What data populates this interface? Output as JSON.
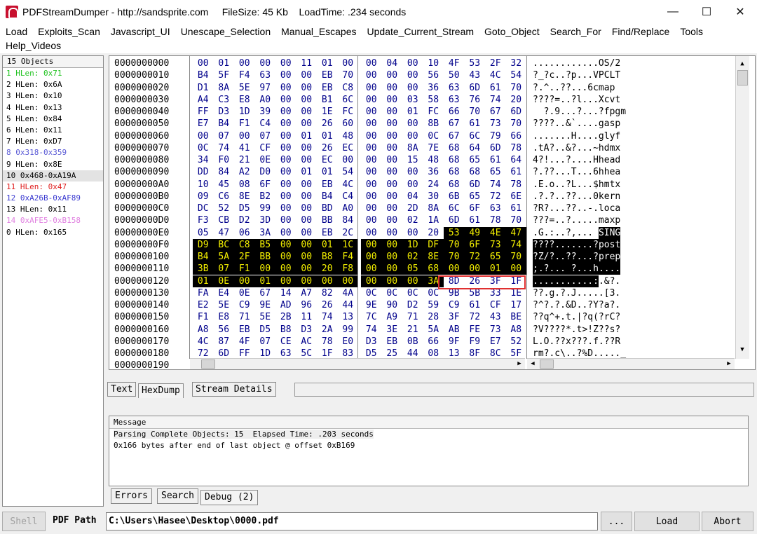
{
  "window": {
    "title": "PDFStreamDumper - http://sandsprite.com     FileSize: 45 Kb    LoadTime: .234 seconds",
    "minimize": "—",
    "maximize": "☐",
    "close": "✕",
    "accent": "#c8102e"
  },
  "menu": {
    "row1": [
      "Load",
      "Exploits_Scan",
      "Javascript_UI",
      "Unescape_Selection",
      "Manual_Escapes",
      "Update_Current_Stream",
      "Goto_Object",
      "Search_For",
      "Find/Replace",
      "Tools"
    ],
    "row2": [
      "Help_Videos"
    ]
  },
  "objects": {
    "header": "15 Objects",
    "items": [
      {
        "label": "1 HLen: 0x71",
        "color": "#22c322"
      },
      {
        "label": "2 HLen: 0x6A",
        "color": "#000000"
      },
      {
        "label": "3 HLen: 0x10",
        "color": "#000000"
      },
      {
        "label": "4 HLen: 0x13",
        "color": "#000000"
      },
      {
        "label": "5 HLen: 0x84",
        "color": "#000000"
      },
      {
        "label": "6 HLen: 0x11",
        "color": "#000000"
      },
      {
        "label": "7 HLen: 0xD7",
        "color": "#000000"
      },
      {
        "label": "8 0x318-0x359",
        "color": "#5b5bd6"
      },
      {
        "label": "9 HLen: 0x8E",
        "color": "#000000"
      },
      {
        "label": "10 0x468-0xA19A",
        "color": "#000000",
        "selected": true
      },
      {
        "label": "11 HLen: 0x47",
        "color": "#e02020"
      },
      {
        "label": "12 0xA26B-0xAF89",
        "color": "#3a3ad0"
      },
      {
        "label": "13 HLen: 0x11",
        "color": "#000000"
      },
      {
        "label": "14 0xAFE5-0xB158",
        "color": "#e080e0"
      },
      {
        "label": "0 HLen: 0x165",
        "color": "#000000"
      }
    ]
  },
  "hexdump": {
    "rows": [
      {
        "offset": "0000000000",
        "bytes": [
          "00",
          "01",
          "00",
          "00",
          "00",
          "11",
          "01",
          "00",
          "00",
          "04",
          "00",
          "10",
          "4F",
          "53",
          "2F",
          "32"
        ],
        "ascii": "............OS/2"
      },
      {
        "offset": "0000000010",
        "bytes": [
          "B4",
          "5F",
          "F4",
          "63",
          "00",
          "00",
          "EB",
          "70",
          "00",
          "00",
          "00",
          "56",
          "50",
          "43",
          "4C",
          "54"
        ],
        "ascii": "?_?c..?p...VPCLT"
      },
      {
        "offset": "0000000020",
        "bytes": [
          "D1",
          "8A",
          "5E",
          "97",
          "00",
          "00",
          "EB",
          "C8",
          "00",
          "00",
          "00",
          "36",
          "63",
          "6D",
          "61",
          "70"
        ],
        "ascii": "?.^..??...6cmap"
      },
      {
        "offset": "0000000030",
        "bytes": [
          "A4",
          "C3",
          "E8",
          "A0",
          "00",
          "00",
          "B1",
          "6C",
          "00",
          "00",
          "03",
          "58",
          "63",
          "76",
          "74",
          "20"
        ],
        "ascii": "????=..?l...Xcvt"
      },
      {
        "offset": "0000000040",
        "bytes": [
          "FF",
          "D3",
          "1D",
          "39",
          "00",
          "00",
          "1E",
          "FC",
          "00",
          "00",
          "01",
          "FC",
          "66",
          "70",
          "67",
          "6D"
        ],
        "ascii": "  ?.9...?...?fpgm"
      },
      {
        "offset": "0000000050",
        "bytes": [
          "E7",
          "B4",
          "F1",
          "C4",
          "00",
          "00",
          "26",
          "60",
          "00",
          "00",
          "00",
          "8B",
          "67",
          "61",
          "73",
          "70"
        ],
        "ascii": "????..&`....gasp"
      },
      {
        "offset": "0000000060",
        "bytes": [
          "00",
          "07",
          "00",
          "07",
          "00",
          "01",
          "01",
          "48",
          "00",
          "00",
          "00",
          "0C",
          "67",
          "6C",
          "79",
          "66"
        ],
        "ascii": ".......H....glyf"
      },
      {
        "offset": "0000000070",
        "bytes": [
          "0C",
          "74",
          "41",
          "CF",
          "00",
          "00",
          "26",
          "EC",
          "00",
          "00",
          "8A",
          "7E",
          "68",
          "64",
          "6D",
          "78"
        ],
        "ascii": ".tA?..&?...~hdmx"
      },
      {
        "offset": "0000000080",
        "bytes": [
          "34",
          "F0",
          "21",
          "0E",
          "00",
          "00",
          "EC",
          "00",
          "00",
          "00",
          "15",
          "48",
          "68",
          "65",
          "61",
          "64"
        ],
        "ascii": "4?!...?....Hhead"
      },
      {
        "offset": "0000000090",
        "bytes": [
          "DD",
          "84",
          "A2",
          "D0",
          "00",
          "01",
          "01",
          "54",
          "00",
          "00",
          "00",
          "36",
          "68",
          "68",
          "65",
          "61"
        ],
        "ascii": "?.??...T...6hhea"
      },
      {
        "offset": "00000000A0",
        "bytes": [
          "10",
          "45",
          "08",
          "6F",
          "00",
          "00",
          "EB",
          "4C",
          "00",
          "00",
          "00",
          "24",
          "68",
          "6D",
          "74",
          "78"
        ],
        "ascii": ".E.o..?L...$hmtx"
      },
      {
        "offset": "00000000B0",
        "bytes": [
          "09",
          "C6",
          "8E",
          "B2",
          "00",
          "00",
          "B4",
          "C4",
          "00",
          "00",
          "04",
          "30",
          "6B",
          "65",
          "72",
          "6E"
        ],
        "ascii": ".?.?..??...0kern"
      },
      {
        "offset": "00000000C0",
        "bytes": [
          "DC",
          "52",
          "D5",
          "99",
          "00",
          "00",
          "BD",
          "A0",
          "00",
          "00",
          "2D",
          "8A",
          "6C",
          "6F",
          "63",
          "61"
        ],
        "ascii": "?R?...??..-.loca"
      },
      {
        "offset": "00000000D0",
        "bytes": [
          "F3",
          "CB",
          "D2",
          "3D",
          "00",
          "00",
          "BB",
          "84",
          "00",
          "00",
          "02",
          "1A",
          "6D",
          "61",
          "78",
          "70"
        ],
        "ascii": "???=..?.....maxp"
      },
      {
        "offset": "00000000E0",
        "bytes": [
          "05",
          "47",
          "06",
          "3A",
          "00",
          "00",
          "EB",
          "2C",
          "00",
          "00",
          "00",
          "20",
          "53",
          "49",
          "4E",
          "47"
        ],
        "ascii": ".G.:..?,... SING"
      },
      {
        "offset": "00000000F0",
        "bytes": [
          "D9",
          "BC",
          "C8",
          "B5",
          "00",
          "00",
          "01",
          "1C",
          "00",
          "00",
          "1D",
          "DF",
          "70",
          "6F",
          "73",
          "74"
        ],
        "ascii": "????.......?post"
      },
      {
        "offset": "0000000100",
        "bytes": [
          "B4",
          "5A",
          "2F",
          "BB",
          "00",
          "00",
          "B8",
          "F4",
          "00",
          "00",
          "02",
          "8E",
          "70",
          "72",
          "65",
          "70"
        ],
        "ascii": "?Z/?..??...?prep"
      },
      {
        "offset": "0000000110",
        "bytes": [
          "3B",
          "07",
          "F1",
          "00",
          "00",
          "00",
          "20",
          "F8",
          "00",
          "00",
          "05",
          "68",
          "00",
          "00",
          "01",
          "00"
        ],
        "ascii": ";.?... ?...h...."
      },
      {
        "offset": "0000000120",
        "bytes": [
          "01",
          "0E",
          "00",
          "01",
          "00",
          "00",
          "00",
          "00",
          "00",
          "00",
          "00",
          "3A",
          "8D",
          "26",
          "3F",
          "1F"
        ],
        "ascii": "...........:.&?."
      },
      {
        "offset": "0000000130",
        "bytes": [
          "FA",
          "E4",
          "0E",
          "67",
          "14",
          "A7",
          "82",
          "4A",
          "0C",
          "0C",
          "0C",
          "0C",
          "9B",
          "5B",
          "33",
          "1E"
        ],
        "ascii": "??.g.?.J.....[3."
      },
      {
        "offset": "0000000140",
        "bytes": [
          "E2",
          "5E",
          "C9",
          "9E",
          "AD",
          "96",
          "26",
          "44",
          "9E",
          "90",
          "D2",
          "59",
          "C9",
          "61",
          "CF",
          "17"
        ],
        "ascii": "?^?.?.&D..?Y?a?."
      },
      {
        "offset": "0000000150",
        "bytes": [
          "F1",
          "E8",
          "71",
          "5E",
          "2B",
          "11",
          "74",
          "13",
          "7C",
          "A9",
          "71",
          "28",
          "3F",
          "72",
          "43",
          "BE"
        ],
        "ascii": "??q^+.t.|?q(?rC?"
      },
      {
        "offset": "0000000160",
        "bytes": [
          "A8",
          "56",
          "EB",
          "D5",
          "B8",
          "D3",
          "2A",
          "99",
          "74",
          "3E",
          "21",
          "5A",
          "AB",
          "FE",
          "73",
          "A8"
        ],
        "ascii": "?V????*.t>!Z??s?"
      },
      {
        "offset": "0000000170",
        "bytes": [
          "4C",
          "87",
          "4F",
          "07",
          "CE",
          "AC",
          "78",
          "E0",
          "D3",
          "EB",
          "0B",
          "66",
          "9F",
          "F9",
          "E7",
          "52"
        ],
        "ascii": "L.O.??x???.f.??R"
      },
      {
        "offset": "0000000180",
        "bytes": [
          "72",
          "6D",
          "FF",
          "1D",
          "63",
          "5C",
          "1F",
          "83",
          "D5",
          "25",
          "44",
          "08",
          "13",
          "8F",
          "8C",
          "5F"
        ],
        "ascii": "rm?.c\\..?%D....._"
      },
      {
        "offset": "0000000190",
        "bytes": [
          "",
          "",
          "",
          "",
          "",
          "",
          "",
          "",
          "",
          "",
          "",
          "",
          "",
          "",
          "",
          ""
        ],
        "ascii": ""
      }
    ]
  },
  "tabs": [
    "Text",
    "HexDump",
    "Stream Details"
  ],
  "messages": {
    "header": "Message",
    "lines": [
      "Parsing Complete Objects: 15  Elapsed Time: .203 seconds",
      "0x166 bytes after end of last object @ offset 0xB169"
    ]
  },
  "bottom_tabs": [
    "Errors",
    "Search",
    "Debug (2)"
  ],
  "bottom": {
    "shell": "Shell",
    "path_label": "PDF Path",
    "path_value": "C:\\Users\\Hasee\\Desktop\\0000.pdf",
    "browse": "...",
    "load": "Load",
    "abort": "Abort"
  }
}
